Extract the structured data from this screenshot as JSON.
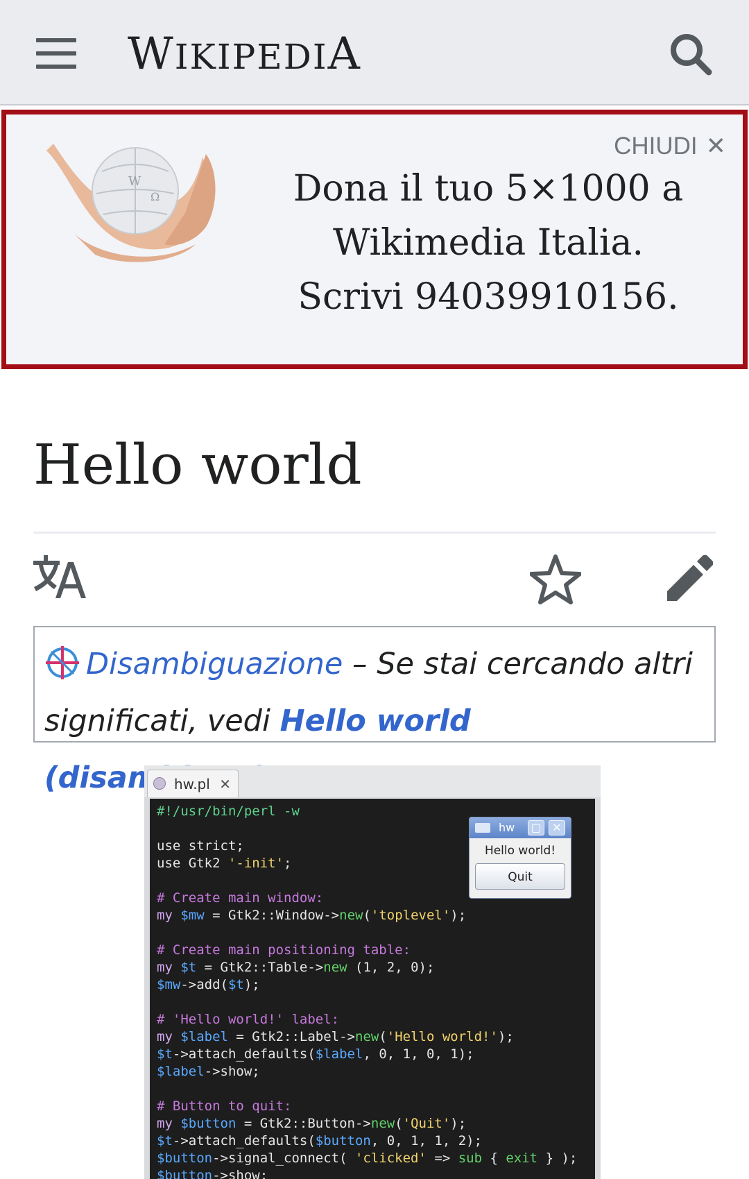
{
  "header": {
    "wordmark_first": "W",
    "wordmark_middle": "IKIPEDI",
    "wordmark_last": "A"
  },
  "banner": {
    "close_label": "CHIUDI",
    "close_glyph": "✕",
    "lines": [
      "Dona il tuo 5×1000 a",
      "Wikimedia Italia.",
      "Scrivi 94039910156."
    ]
  },
  "page": {
    "title": "Hello world"
  },
  "hatnote": {
    "link_text": "Disambiguazione",
    "middle_text": " – Se stai cercando altri significati, vedi ",
    "bold_link": "Hello world (disambigua)",
    "end_text": "."
  },
  "figure": {
    "tab_label": "hw.pl",
    "tab_close": "✕",
    "code_lines": [
      "#!/usr/bin/perl -w",
      "",
      "use strict;",
      "use Gtk2 '-init';",
      "",
      "# Create main window:",
      "my $mw = Gtk2::Window->new('toplevel');",
      "",
      "# Create main positioning table:",
      "my $t = Gtk2::Table->new (1, 2, 0);",
      "$mw->add($t);",
      "",
      "# 'Hello world!' label:",
      "my $label = Gtk2::Label->new('Hello world!');",
      "$t->attach_defaults($label, 0, 1, 0, 1);",
      "$label->show;",
      "",
      "# Button to quit:",
      "my $button = Gtk2::Button->new('Quit');",
      "$t->attach_defaults($button, 0, 1, 1, 2);",
      "$button->signal_connect( 'clicked' => sub { exit } );",
      "$button->show;"
    ],
    "gtk_window": {
      "title": "hw",
      "label": "Hello world!",
      "button": "Quit"
    }
  },
  "colors": {
    "banner_border": "#a30d15",
    "link": "#3366cc",
    "header_bg": "#eaecf0"
  },
  "icons": [
    "menu-icon",
    "search-icon",
    "wikipedia-globe-hands-image",
    "close-icon",
    "language-icon",
    "star-icon",
    "edit-pencil-icon",
    "disambiguation-icon"
  ]
}
